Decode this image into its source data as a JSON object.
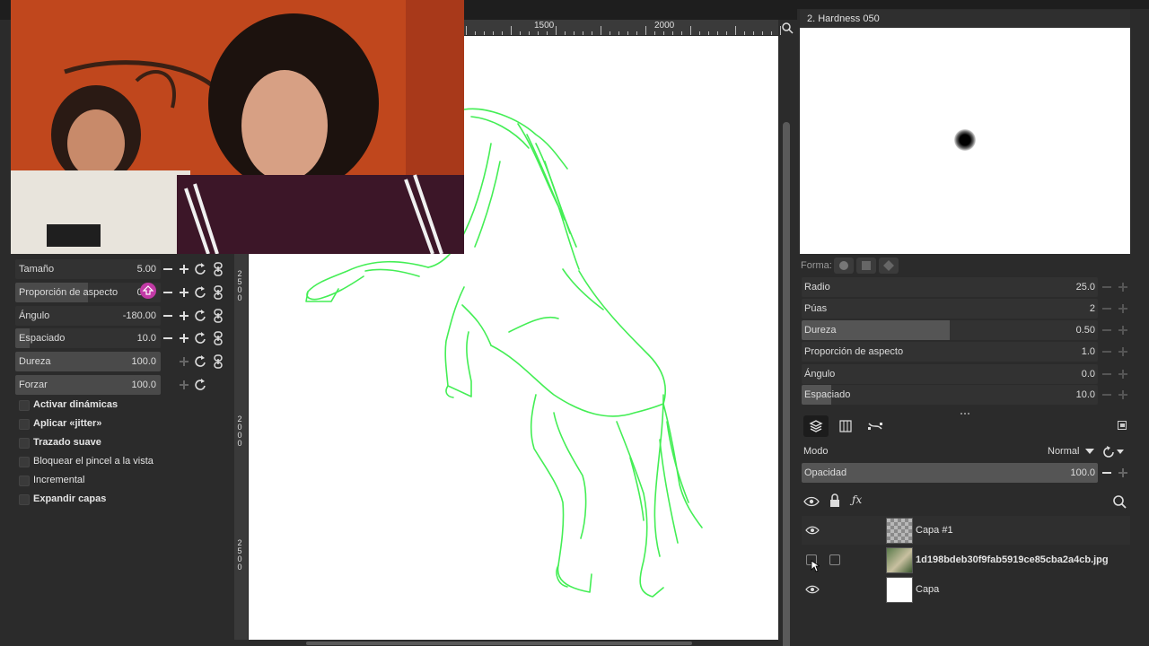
{
  "ruler": {
    "label_1500": "1500",
    "label_2000": "2000"
  },
  "ruler_left": {
    "label_a": [
      "2",
      "5",
      "0",
      "0"
    ],
    "label_b": [
      "2",
      "0",
      "0",
      "0"
    ],
    "label_c": [
      "2",
      "5",
      "0",
      "0"
    ]
  },
  "tool_options": {
    "rows": [
      {
        "label": "Tamaño",
        "value": "5.00",
        "fill_fraction": 0.0
      },
      {
        "label": "Proporción de aspecto",
        "value": "0.10",
        "fill_fraction": 0.5
      },
      {
        "label": "Ángulo",
        "value": "-180.00",
        "fill_fraction": 0.0
      },
      {
        "label": "Espaciado",
        "value": "10.0",
        "fill_fraction": 0.1
      },
      {
        "label": "Dureza",
        "value": "100.0",
        "fill_fraction": 1.0
      },
      {
        "label": "Forzar",
        "value": "100.0",
        "fill_fraction": 1.0
      }
    ],
    "checks": [
      {
        "label": "Activar dinámicas",
        "bold": true
      },
      {
        "label": "Aplicar «jitter»",
        "bold": true
      },
      {
        "label": "Trazado suave",
        "bold": true
      },
      {
        "label": "Bloquear el pincel a la vista",
        "bold": false
      },
      {
        "label": "Incremental",
        "bold": false
      },
      {
        "label": "Expandir capas",
        "bold": true
      }
    ]
  },
  "brush": {
    "title": "2. Hardness 050",
    "shape_label": "Forma:",
    "params": [
      {
        "label": "Radio",
        "value": "25.0",
        "fill_fraction": 0.0
      },
      {
        "label": "Púas",
        "value": "2",
        "fill_fraction": 0.0
      },
      {
        "label": "Dureza",
        "value": "0.50",
        "fill_fraction": 0.5
      },
      {
        "label": "Proporción de aspecto",
        "value": "1.0",
        "fill_fraction": 0.0
      },
      {
        "label": "Ángulo",
        "value": "0.0",
        "fill_fraction": 0.0
      },
      {
        "label": "Espaciado",
        "value": "10.0",
        "fill_fraction": 0.1
      }
    ]
  },
  "layers": {
    "mode_label": "Modo",
    "mode_value": "Normal",
    "opacity_label": "Opacidad",
    "opacity_value": "100.0",
    "items": [
      {
        "name": "Capa #1",
        "visible": true,
        "bold": false
      },
      {
        "name": "1d198bdeb30f9fab5919ce85cba2a4cb.jpg",
        "visible": false,
        "bold": true
      },
      {
        "name": "Capa",
        "visible": true,
        "bold": false
      }
    ]
  },
  "colors": {
    "stroke": "#44ee55",
    "accent": "#c23aa6",
    "panel": "#2b2b2b"
  }
}
